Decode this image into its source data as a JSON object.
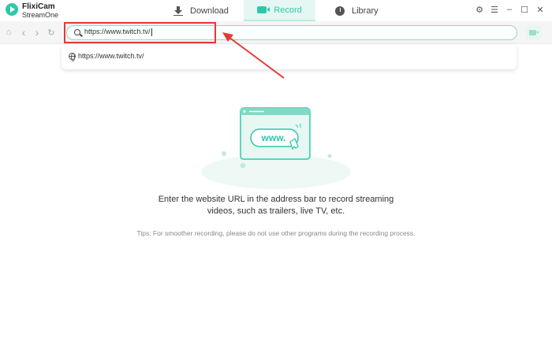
{
  "app": {
    "brand_line1": "FlixiCam",
    "brand_line2": "StreamOne"
  },
  "tabs": [
    {
      "label": "Download",
      "icon": "download-icon"
    },
    {
      "label": "Record",
      "icon": "record-icon",
      "active": true
    },
    {
      "label": "Library",
      "icon": "library-icon"
    }
  ],
  "window_controls": {
    "settings": "⚙",
    "menu": "☰",
    "minimize": "–",
    "maximize": "☐",
    "close": "✕"
  },
  "nav": {
    "home": "⌂",
    "back": "‹",
    "forward": "›",
    "refresh": "↻"
  },
  "address": {
    "value": "https://www.twitch.tv/"
  },
  "suggestion": {
    "text": "https://www.twitch.tv/"
  },
  "illustration": {
    "label": "www."
  },
  "messages": {
    "line1": "Enter the website URL in the address bar to record streaming",
    "line2": "videos, such as trailers, live TV, etc.",
    "tips": "Tips: For smoother recording, please do not use other programs during the recording process."
  },
  "colors": {
    "accent": "#2cc9a9",
    "annotation": "#e53935"
  }
}
